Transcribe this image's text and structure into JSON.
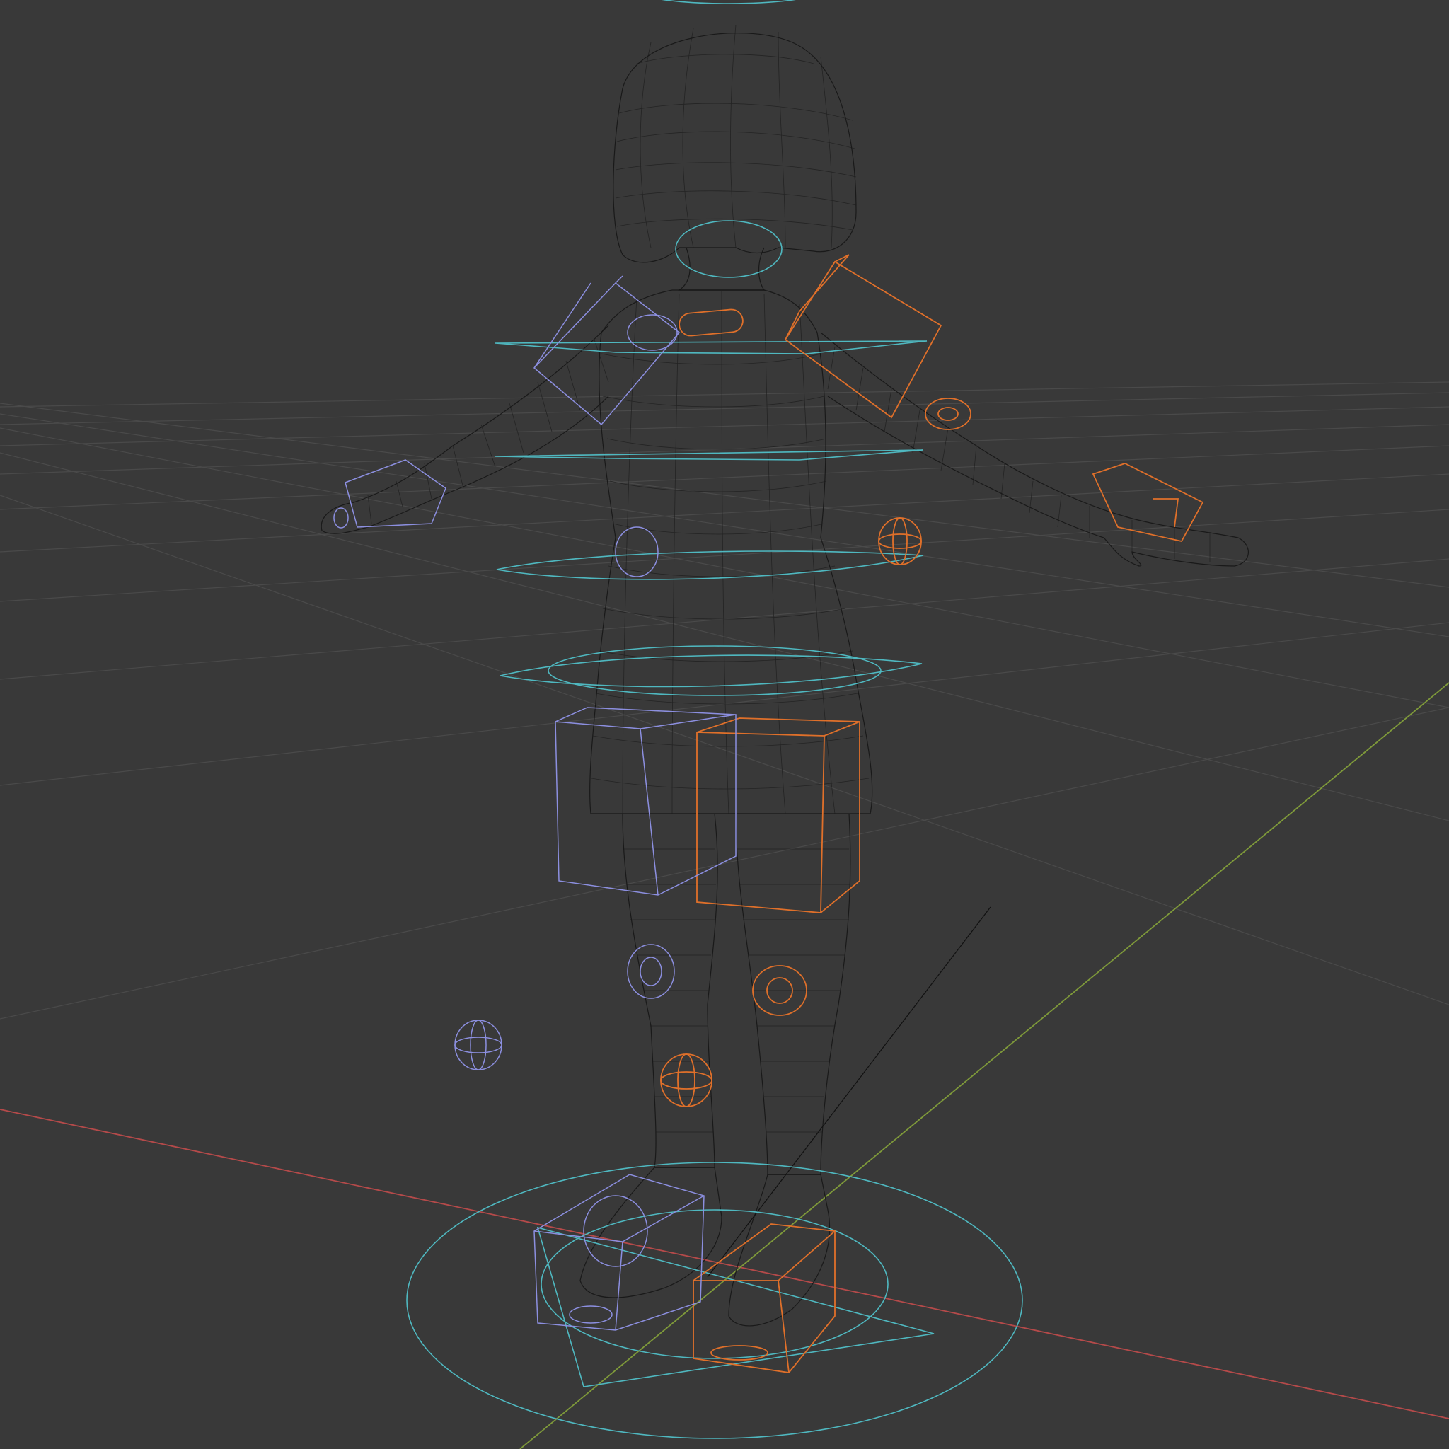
{
  "viewport": {
    "mode": "wireframe",
    "subject": "rigged-character-a-pose"
  },
  "colors": {
    "background": "#393939",
    "grid": "#4a4a4a",
    "axis_x": "#b54a4a",
    "axis_y": "#7f9a3a",
    "mesh_wire": "#141414",
    "control_center": "#4fb8c0",
    "control_left": "#e0702a",
    "control_right": "#8c8fe0"
  }
}
